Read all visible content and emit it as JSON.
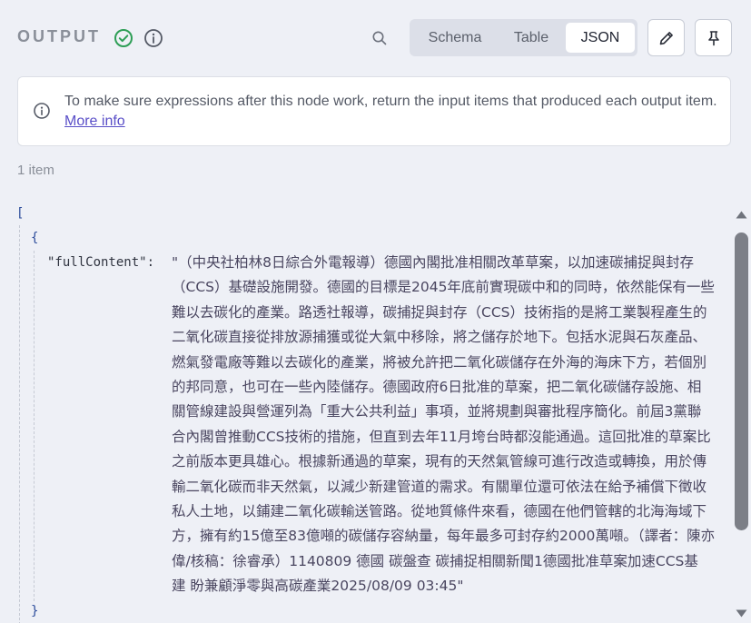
{
  "header": {
    "title": "OUTPUT",
    "view_tabs": [
      {
        "label": "Schema",
        "active": false
      },
      {
        "label": "Table",
        "active": false
      },
      {
        "label": "JSON",
        "active": true
      }
    ]
  },
  "callout": {
    "message": "To make sure expressions after this node work, return the input items that produced each output item.",
    "link_text": "More info"
  },
  "item_count": "1 item",
  "json_view": {
    "open_bracket": "[",
    "open_brace": "{",
    "close_brace": "}",
    "key": "\"fullContent\":",
    "value_lines": [
      "\"（中央社柏林8日綜合外電報導）德國內閣批准相關改革草案，以加速碳捕捉與封存",
      "（CCS）基礎設施開發。德國的目標是2045年底前實現碳中和的同時，依然能保有一些",
      "難以去碳化的產業。路透社報導，碳捕捉與封存（CCS）技術指的是將工業製程產生的",
      "二氧化碳直接從排放源捕獲或從大氣中移除，將之儲存於地下。包括水泥與石灰產品、",
      "燃氣發電廠等難以去碳化的產業，將被允許把二氧化碳儲存在外海的海床下方，若個別",
      "的邦同意，也可在一些內陸儲存。德國政府6日批准的草案，把二氧化碳儲存設施、相",
      "關管線建設與營運列為「重大公共利益」事項，並將規劃與審批程序簡化。前屆3黨聯",
      "合內閣曾推動CCS技術的措施，但直到去年11月垮台時都沒能通過。這回批准的草案比",
      "之前版本更具雄心。根據新通過的草案，現有的天然氣管線可進行改造或轉換，用於傳",
      "輸二氧化碳而非天然氣，以減少新建管道的需求。有關單位還可依法在給予補償下徵收",
      "私人土地，以鋪建二氧化碳輸送管路。從地質條件來看，德國在他們管轄的北海海域下",
      "方，擁有約15億至83億噸的碳儲存容納量，每年最多可封存約2000萬噸。（譯者：陳亦",
      "偉/核稿：徐睿承）1140809 德國 碳盤查 碳捕捉相關新聞1德國批准草案加速CCS基",
      "建  盼兼顧淨零與高碳產業2025/08/09 03:45\""
    ]
  },
  "colors": {
    "accent": "#5a4fc8",
    "success": "#2e9e56",
    "background": "#eef0f6"
  },
  "icons": [
    "check-circle-icon",
    "info-icon",
    "search-icon",
    "pencil-icon",
    "pin-icon"
  ]
}
